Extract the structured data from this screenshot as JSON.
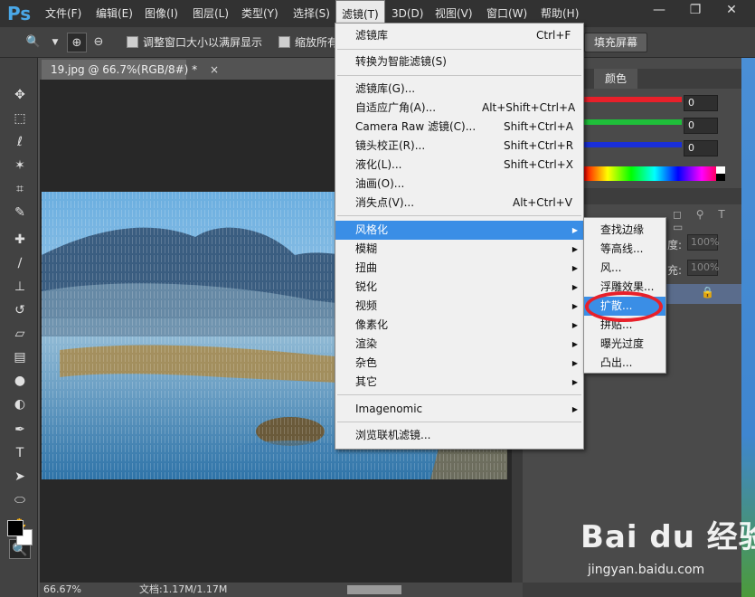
{
  "app": {
    "logo": "Ps"
  },
  "menubar": {
    "items": [
      {
        "label": "文件(F)"
      },
      {
        "label": "编辑(E)"
      },
      {
        "label": "图像(I)"
      },
      {
        "label": "图层(L)"
      },
      {
        "label": "类型(Y)"
      },
      {
        "label": "选择(S)"
      },
      {
        "label": "滤镜(T)"
      },
      {
        "label": "3D(D)"
      },
      {
        "label": "视图(V)"
      },
      {
        "label": "窗口(W)"
      },
      {
        "label": "帮助(H)"
      }
    ],
    "window_controls": {
      "minimize": "—",
      "restore": "❐",
      "close": "✕"
    }
  },
  "options_bar": {
    "resize_windows_label": "调整窗口大小以满屏显示",
    "zoom_all_label": "缩放所有",
    "fill_screen_label": "填充屏幕"
  },
  "document": {
    "tab_title": "19.jpg @ 66.7%(RGB/8#) *",
    "tab_close": "×",
    "status_zoom": "66.67%",
    "status_doc": "文档:1.17M/1.17M"
  },
  "color_panel": {
    "tab_label": "颜色",
    "r_value": "0",
    "g_value": "0",
    "b_value": "0",
    "colors": {
      "r": "#e8202a",
      "g": "#1fbf3a",
      "b": "#1a2fd8"
    }
  },
  "layers_panel": {
    "opacity_label": "度:",
    "opacity_value": "100%",
    "fill_label": "充:",
    "fill_value": "100%",
    "lock_icon": "🔒"
  },
  "filter_menu": {
    "items": [
      {
        "label": "滤镜库",
        "shortcut": "Ctrl+F"
      },
      {
        "label": "转换为智能滤镜(S)"
      },
      {
        "label": "滤镜库(G)..."
      },
      {
        "label": "自适应广角(A)...",
        "shortcut": "Alt+Shift+Ctrl+A"
      },
      {
        "label": "Camera Raw 滤镜(C)...",
        "shortcut": "Shift+Ctrl+A"
      },
      {
        "label": "镜头校正(R)...",
        "shortcut": "Shift+Ctrl+R"
      },
      {
        "label": "液化(L)...",
        "shortcut": "Shift+Ctrl+X"
      },
      {
        "label": "油画(O)..."
      },
      {
        "label": "消失点(V)...",
        "shortcut": "Alt+Ctrl+V"
      },
      {
        "label": "风格化"
      },
      {
        "label": "模糊"
      },
      {
        "label": "扭曲"
      },
      {
        "label": "锐化"
      },
      {
        "label": "视频"
      },
      {
        "label": "像素化"
      },
      {
        "label": "渲染"
      },
      {
        "label": "杂色"
      },
      {
        "label": "其它"
      },
      {
        "label": "Imagenomic"
      },
      {
        "label": "浏览联机滤镜..."
      }
    ]
  },
  "stylize_menu": {
    "items": [
      {
        "label": "查找边缘"
      },
      {
        "label": "等高线..."
      },
      {
        "label": "风..."
      },
      {
        "label": "浮雕效果..."
      },
      {
        "label": "扩散..."
      },
      {
        "label": "拼贴..."
      },
      {
        "label": "曝光过度"
      },
      {
        "label": "凸出..."
      }
    ]
  },
  "watermark": {
    "logo": "Bai du 经验",
    "url": "jingyan.baidu.com"
  }
}
